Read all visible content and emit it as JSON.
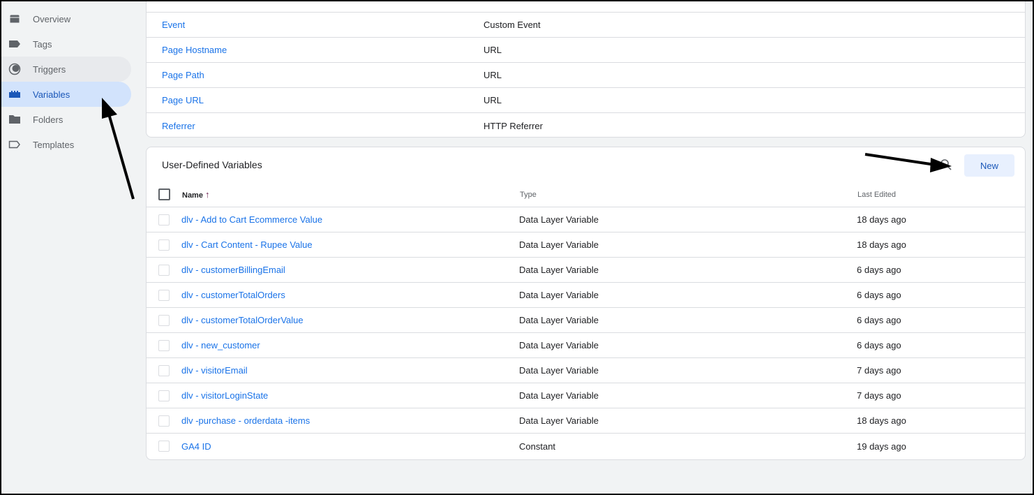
{
  "sidebar": {
    "items": [
      {
        "label": "Overview",
        "icon": "overview-icon"
      },
      {
        "label": "Tags",
        "icon": "tag-icon"
      },
      {
        "label": "Triggers",
        "icon": "trigger-icon"
      },
      {
        "label": "Variables",
        "icon": "variables-icon",
        "active": true
      },
      {
        "label": "Folders",
        "icon": "folder-icon"
      },
      {
        "label": "Templates",
        "icon": "template-icon"
      }
    ]
  },
  "builtin": {
    "rows": [
      {
        "name": "Event",
        "type": "Custom Event"
      },
      {
        "name": "Page Hostname",
        "type": "URL"
      },
      {
        "name": "Page Path",
        "type": "URL"
      },
      {
        "name": "Page URL",
        "type": "URL"
      },
      {
        "name": "Referrer",
        "type": "HTTP Referrer"
      }
    ]
  },
  "user": {
    "title": "User-Defined Variables",
    "new_label": "New",
    "headers": {
      "name": "Name",
      "sort": "↑",
      "type": "Type",
      "edited": "Last Edited"
    },
    "rows": [
      {
        "name": "dlv - Add to Cart Ecommerce Value",
        "type": "Data Layer Variable",
        "edited": "18 days ago"
      },
      {
        "name": "dlv - Cart Content - Rupee Value",
        "type": "Data Layer Variable",
        "edited": "18 days ago"
      },
      {
        "name": "dlv - customerBillingEmail",
        "type": "Data Layer Variable",
        "edited": "6 days ago"
      },
      {
        "name": "dlv - customerTotalOrders",
        "type": "Data Layer Variable",
        "edited": "6 days ago"
      },
      {
        "name": "dlv - customerTotalOrderValue",
        "type": "Data Layer Variable",
        "edited": "6 days ago"
      },
      {
        "name": "dlv - new_customer",
        "type": "Data Layer Variable",
        "edited": "6 days ago"
      },
      {
        "name": "dlv - visitorEmail",
        "type": "Data Layer Variable",
        "edited": "7 days ago"
      },
      {
        "name": "dlv - visitorLoginState",
        "type": "Data Layer Variable",
        "edited": "7 days ago"
      },
      {
        "name": "dlv -purchase - orderdata -items",
        "type": "Data Layer Variable",
        "edited": "18 days ago"
      },
      {
        "name": "GA4 ID",
        "type": "Constant",
        "edited": "19 days ago"
      }
    ]
  }
}
